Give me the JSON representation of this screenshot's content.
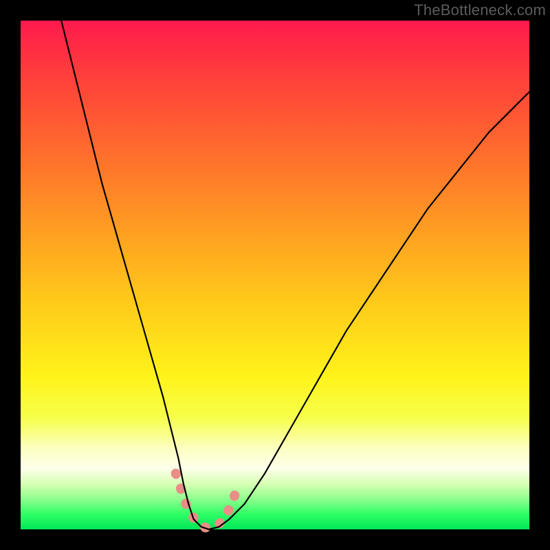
{
  "watermark": {
    "text": "TheBottleneck.com"
  },
  "chart_data": {
    "type": "line",
    "title": "",
    "xlabel": "",
    "ylabel": "",
    "xlim": [
      0,
      100
    ],
    "ylim": [
      0,
      100
    ],
    "series": [
      {
        "name": "primary-curve",
        "x": [
          8,
          10,
          12,
          14,
          16,
          18,
          20,
          22,
          24,
          26,
          28,
          29.5,
          31,
          32,
          33,
          34,
          35.5,
          37,
          39,
          41,
          44,
          48,
          52,
          56,
          60,
          64,
          68,
          72,
          76,
          80,
          84,
          88,
          92,
          96,
          100
        ],
        "y": [
          100,
          92,
          84,
          76,
          68,
          61,
          54,
          47,
          40,
          33,
          26,
          20,
          14,
          9,
          5,
          2,
          0.5,
          0,
          0.5,
          2,
          5,
          11,
          18,
          25,
          32,
          39,
          45,
          51,
          57,
          63,
          68,
          73,
          78,
          82,
          86
        ],
        "color": "#000000",
        "width": 2.2
      },
      {
        "name": "highlight-segment",
        "x": [
          30.5,
          31.5,
          32.5,
          33.5,
          34.5,
          35.5,
          36.5,
          37.5,
          38.5,
          39.5,
          40.5,
          41.5,
          42.5
        ],
        "y": [
          11,
          8,
          5,
          3,
          1.5,
          0.7,
          0.3,
          0.3,
          0.7,
          1.5,
          3,
          5,
          8
        ],
        "color": "#e98d86",
        "width": 14
      }
    ],
    "background_gradient": [
      "#ff1a4d",
      "#fff31a",
      "#00e657"
    ]
  }
}
